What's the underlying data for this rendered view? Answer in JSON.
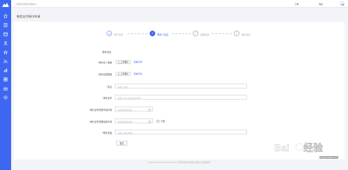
{
  "header": {
    "brand": "河南省农信社管理中心",
    "links": [
      "工单",
      "消息"
    ]
  },
  "page": {
    "title": "微信支付接口申请"
  },
  "steps": [
    {
      "number": "1",
      "label": "商户信息",
      "state": "done"
    },
    {
      "number": "2",
      "label": "联系人信息",
      "state": "active"
    },
    {
      "number": "3",
      "label": "结算信息",
      "state": "pending"
    },
    {
      "number": "4",
      "label": "确认提交",
      "state": "pending"
    }
  ],
  "form": {
    "section_title": "联系信息",
    "id_front": {
      "label": "身份证人像面",
      "button": "上 上传图片",
      "sample": "查看示例"
    },
    "id_back": {
      "label": "身份证国徽面",
      "button": "上 上传图片",
      "sample": "查看示例"
    },
    "name": {
      "label": "姓名",
      "placeholder": "请输入姓名"
    },
    "id_number": {
      "label": "身份证号",
      "placeholder": "请输入法人的身份证号码"
    },
    "valid_start": {
      "label": "身份证有效期开始时间",
      "placeholder": "请选择开始时间"
    },
    "valid_end": {
      "label": "身份证有效期结束时间",
      "placeholder": "请选择结束时间",
      "long_term": "长期"
    },
    "phone": {
      "label": "联系电话",
      "placeholder": "请输入联系电话"
    },
    "submit": "提交"
  },
  "footer": "Copyright 2012-2019 hnxuecan.com 河南省农信社管理中心有限公司 版权所有",
  "watermark": {
    "text": "Baidu 经验",
    "url": "jingyan.baidu.com"
  },
  "colors": {
    "accent": "#3d67f1",
    "required": "#e6403a",
    "background": "#f3f4f7"
  },
  "icons": {
    "sidebar": [
      "home-icon",
      "document-icon",
      "calendar-icon",
      "user-icon",
      "star-icon",
      "rss-icon",
      "chart-icon",
      "grid-icon",
      "gift-icon",
      "settings-icon"
    ]
  }
}
